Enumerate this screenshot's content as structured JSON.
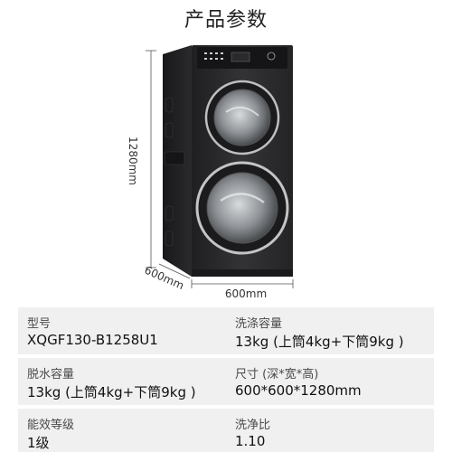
{
  "page": {
    "title": "产品参数"
  },
  "dimensions": {
    "height": "1280mm",
    "depth": "600mm",
    "width": "600mm"
  },
  "specs": [
    {
      "label": "型号",
      "value": "XQGF130-B1258U1"
    },
    {
      "label": "洗涤容量",
      "value": "13kg (上筒4kg+下筒9kg )"
    },
    {
      "label": "脱水容量",
      "value": "13kg (上筒4kg+下筒9kg )"
    },
    {
      "label": "尺寸 (深*宽*高)",
      "value": "600*600*1280mm"
    },
    {
      "label": "能效等级",
      "value": "1级"
    },
    {
      "label": "洗净比",
      "value": "1.10"
    }
  ],
  "colors": {
    "machine_body": "#2b2b2d",
    "spec_background": "#f0f0f0"
  }
}
